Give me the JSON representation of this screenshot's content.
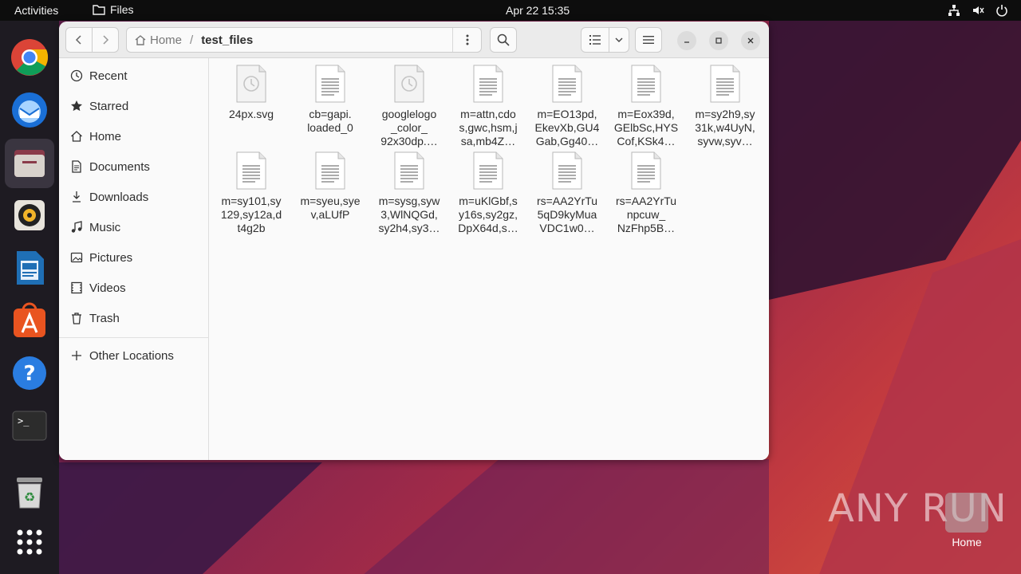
{
  "topbar": {
    "activities": "Activities",
    "app_name": "Files",
    "clock": "Apr 22  15:35"
  },
  "dock": {
    "items": [
      "chrome-icon",
      "thunderbird-icon",
      "files-icon",
      "rhythmbox-icon",
      "writer-icon",
      "app-center-icon",
      "help-icon",
      "terminal-icon",
      "trash-icon",
      "show-apps-icon"
    ]
  },
  "headerbar": {
    "breadcrumb_home": "Home",
    "breadcrumb_separator": "/",
    "breadcrumb_current": "test_files"
  },
  "sidebar": {
    "items": [
      {
        "label": "Recent",
        "icon": "clock-icon"
      },
      {
        "label": "Starred",
        "icon": "star-icon"
      },
      {
        "label": "Home",
        "icon": "home-icon"
      },
      {
        "label": "Documents",
        "icon": "document-icon"
      },
      {
        "label": "Downloads",
        "icon": "download-icon"
      },
      {
        "label": "Music",
        "icon": "music-icon"
      },
      {
        "label": "Pictures",
        "icon": "pictures-icon"
      },
      {
        "label": "Videos",
        "icon": "videos-icon"
      },
      {
        "label": "Trash",
        "icon": "trash-icon"
      }
    ],
    "other_locations": "Other Locations"
  },
  "files": [
    {
      "line1": "24px.svg",
      "line2": "",
      "line3": "",
      "icon": "image-file-icon"
    },
    {
      "line1": "cb=gapi.",
      "line2": "loaded_0",
      "line3": "",
      "icon": "text-file-icon"
    },
    {
      "line1": "googlelogo",
      "line2": "_color_",
      "line3": "92x30dp.…",
      "icon": "image-file-icon"
    },
    {
      "line1": "m=attn,cdo",
      "line2": "s,gwc,hsm,j",
      "line3": "sa,mb4Z…",
      "icon": "text-file-icon"
    },
    {
      "line1": "m=EO13pd,",
      "line2": "EkevXb,GU4",
      "line3": "Gab,Gg40…",
      "icon": "text-file-icon"
    },
    {
      "line1": "m=Eox39d,",
      "line2": "GElbSc,HYS",
      "line3": "Cof,KSk4…",
      "icon": "text-file-icon"
    },
    {
      "line1": "m=sy2h9,sy",
      "line2": "31k,w4UyN,",
      "line3": "syvw,syv…",
      "icon": "text-file-icon"
    },
    {
      "line1": "m=sy101,sy",
      "line2": "129,sy12a,d",
      "line3": "t4g2b",
      "icon": "text-file-icon"
    },
    {
      "line1": "m=syeu,sye",
      "line2": "v,aLUfP",
      "line3": "",
      "icon": "text-file-icon"
    },
    {
      "line1": "m=sysg,syw",
      "line2": "3,WlNQGd,",
      "line3": "sy2h4,sy3…",
      "icon": "text-file-icon"
    },
    {
      "line1": "m=uKlGbf,s",
      "line2": "y16s,sy2gz,",
      "line3": "DpX64d,s…",
      "icon": "text-file-icon"
    },
    {
      "line1": "rs=AA2YrTu",
      "line2": "5qD9kyMua",
      "line3": "VDC1w0…",
      "icon": "text-file-icon"
    },
    {
      "line1": "rs=AA2YrTu",
      "line2": "npcuw_",
      "line3": "NzFhp5B…",
      "icon": "text-file-icon"
    }
  ],
  "desktop": {
    "home_label": "Home",
    "watermark": "ANY RUN"
  }
}
